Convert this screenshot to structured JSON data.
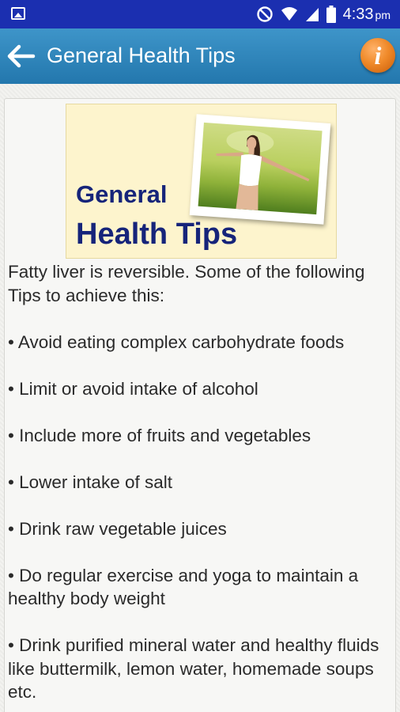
{
  "status_bar": {
    "time": "4:33",
    "ampm": "pm",
    "icons": [
      "image-notification-icon",
      "do-not-disturb-icon",
      "wifi-icon",
      "signal-icon",
      "battery-icon"
    ]
  },
  "app_bar": {
    "title": "General Health Tips",
    "back_icon": "arrow-left-icon",
    "info_label": "i"
  },
  "banner": {
    "line1": "General",
    "line2": "Health Tips"
  },
  "content": {
    "intro": "Fatty liver is reversible. Some of the following Tips to achieve this:",
    "tips": [
      "• Avoid eating complex carbohydrate foods",
      "• Limit or avoid intake of alcohol",
      "• Include more of fruits and vegetables",
      "• Lower intake of salt",
      "• Drink raw vegetable juices",
      "• Do regular exercise and yoga to maintain a healthy body weight",
      "• Drink purified mineral water and healthy fluids like buttermilk, lemon water, homemade soups etc."
    ]
  },
  "colors": {
    "status_bar": "#1b2fb0",
    "app_bar": "#2f86bc",
    "info_button": "#f08a2a",
    "banner_text": "#16247a",
    "banner_bg": "#fdf4cd"
  }
}
